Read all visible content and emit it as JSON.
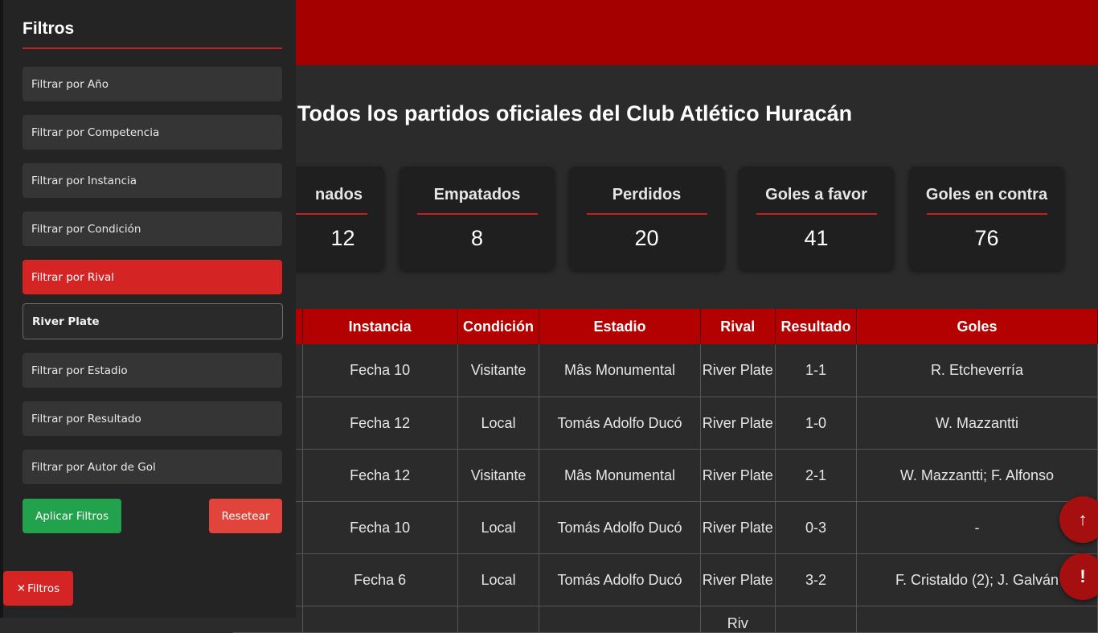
{
  "page": {
    "title": "Todos los partidos oficiales del Club Atlético Huracán"
  },
  "stats": [
    {
      "label": "Ganados",
      "visible_label": "nados",
      "value": "12"
    },
    {
      "label": "Empatados",
      "value": "8"
    },
    {
      "label": "Perdidos",
      "value": "20"
    },
    {
      "label": "Goles a favor",
      "value": "41"
    },
    {
      "label": "Goles en contra",
      "value": "76"
    }
  ],
  "table": {
    "headers": [
      "Instancia",
      "Condición",
      "Estadio",
      "Rival",
      "Resultado",
      "Goles"
    ],
    "rows": [
      {
        "instancia": "Fecha 10",
        "condicion": "Visitante",
        "estadio": "Mâs Monumental",
        "rival": "River Plate",
        "resultado": "1-1",
        "goles": "R. Etcheverría"
      },
      {
        "instancia": "Fecha 12",
        "condicion": "Local",
        "estadio": "Tomás Adolfo Ducó",
        "rival": "River Plate",
        "resultado": "1-0",
        "goles": "W. Mazzantti"
      },
      {
        "instancia": "Fecha 12",
        "condicion": "Visitante",
        "estadio": "Mâs Monumental",
        "rival": "River Plate",
        "resultado": "2-1",
        "goles": "W. Mazzantti; F. Alfonso"
      },
      {
        "instancia": "Fecha 10",
        "condicion": "Local",
        "estadio": "Tomás Adolfo Ducó",
        "rival": "River Plate",
        "resultado": "0-3",
        "goles": "-"
      },
      {
        "instancia": "Fecha 6",
        "condicion": "Local",
        "estadio": "Tomás Adolfo Ducó",
        "rival": "River Plate",
        "resultado": "3-2",
        "goles": "F. Cristaldo (2); J. Galván"
      },
      {
        "instancia": "",
        "condicion": "",
        "estadio": "",
        "rival": "Riv",
        "resultado": "",
        "goles": ""
      }
    ]
  },
  "sidebar": {
    "title": "Filtros",
    "filters": [
      "Filtrar por Año",
      "Filtrar por Competencia",
      "Filtrar por Instancia",
      "Filtrar por Condición",
      "Filtrar por Rival",
      "Filtrar por Estadio",
      "Filtrar por Resultado",
      "Filtrar por Autor de Gol"
    ],
    "active_filter": "Filtrar por Rival",
    "rival_input_value": "River Plate",
    "apply_label": "Aplicar Filtros",
    "reset_label": "Resetear",
    "toggle_label": "Filtros",
    "toggle_icon": "close-icon"
  },
  "fabs": [
    {
      "icon": "arrow-up-icon",
      "glyph": "↑"
    },
    {
      "icon": "alert-icon",
      "glyph": "!"
    }
  ],
  "colors": {
    "brand_red": "#a50000",
    "accent_red": "#d42424",
    "apply_green": "#23a24d",
    "reset_red": "#e0443a",
    "background": "#2b2b2b"
  }
}
